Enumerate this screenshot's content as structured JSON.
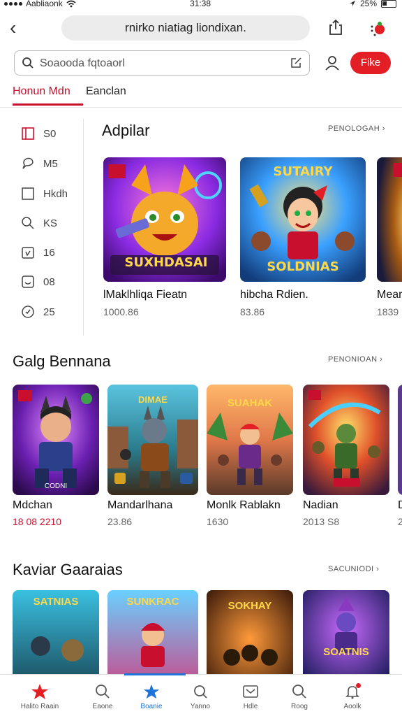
{
  "status": {
    "carrier": "Aabliaonk",
    "time": "31:38",
    "battery": "25%"
  },
  "browser": {
    "url": "rnirko niatiag liondixan."
  },
  "search": {
    "placeholder": "Soaooda fqtoaorl",
    "free_label": "Fike"
  },
  "tabs": [
    {
      "label": "Honun Mdn"
    },
    {
      "label": "Eanclan"
    }
  ],
  "sidebar": {
    "items": [
      {
        "icon": "bookmark-icon",
        "label": "S0"
      },
      {
        "icon": "chat-icon",
        "label": "M5"
      },
      {
        "icon": "square-icon",
        "label": "Hkdh"
      },
      {
        "icon": "search-icon",
        "label": "KS"
      },
      {
        "icon": "calendar-icon",
        "label": "16"
      },
      {
        "icon": "inbox-icon",
        "label": "08"
      },
      {
        "icon": "clock-icon",
        "label": "25"
      }
    ]
  },
  "sections": [
    {
      "title": "Adpilar",
      "more": "PENOLOGAH ›",
      "cards": [
        {
          "name": "lMaklhliqa Fieatn",
          "meta": "1000.86",
          "meta_red": false,
          "art": "a1"
        },
        {
          "name": "hibcha Rdien.",
          "meta": "83.86",
          "meta_red": false,
          "art": "a2"
        },
        {
          "name": "Mear",
          "meta": "1839",
          "meta_red": false,
          "art": "a3"
        }
      ]
    },
    {
      "title": "Galg Bennana",
      "more": "PENONIOAN ›",
      "cards": [
        {
          "name": "Mdchan",
          "meta": "18 08 2210",
          "meta_red": true,
          "art": "b1"
        },
        {
          "name": "Mandarlhana",
          "meta": "23.86",
          "meta_red": false,
          "art": "b2"
        },
        {
          "name": "Monlk Rablakn",
          "meta": "1630",
          "meta_red": false,
          "art": "b3"
        },
        {
          "name": "Nadian",
          "meta": "2013 S8",
          "meta_red": false,
          "art": "b4"
        },
        {
          "name": "D",
          "meta": "2",
          "meta_red": false,
          "art": "b5"
        }
      ]
    },
    {
      "title": "Kaviar Gaaraias",
      "more": "SACUNIODI ›",
      "cards": [
        {
          "name": "",
          "meta": "",
          "meta_red": false,
          "art": "c1"
        },
        {
          "name": "",
          "meta": "",
          "meta_red": false,
          "art": "c2"
        },
        {
          "name": "",
          "meta": "",
          "meta_red": false,
          "art": "c3"
        },
        {
          "name": "",
          "meta": "",
          "meta_red": false,
          "art": "c4"
        }
      ]
    }
  ],
  "art_text": {
    "a1": "SUXHDASAI",
    "a2": "SOLDNIAS",
    "a2top": "SUTAIRY",
    "b1": "CODNI",
    "b2": "DIMAE",
    "b3": "SUAHAK",
    "b4": "",
    "c1": "SATNIAS",
    "c2": "SUNKRAC",
    "c3": "SOKHAY",
    "c4": "SOATNIS"
  },
  "bottom_nav": [
    {
      "icon": "star-logo-icon",
      "label": "Halito Raain"
    },
    {
      "icon": "search-icon",
      "label": "Eaone"
    },
    {
      "icon": "star-icon",
      "label": "Boanie"
    },
    {
      "icon": "refresh-icon",
      "label": "Yanno"
    },
    {
      "icon": "mail-icon",
      "label": "Hdle"
    },
    {
      "icon": "search-icon",
      "label": "Roog"
    },
    {
      "icon": "bell-icon",
      "label": "Aoolk"
    }
  ],
  "colors": {
    "accent": "#c8102e",
    "free_button": "#e31e24",
    "active_nav": "#1e73d8"
  }
}
